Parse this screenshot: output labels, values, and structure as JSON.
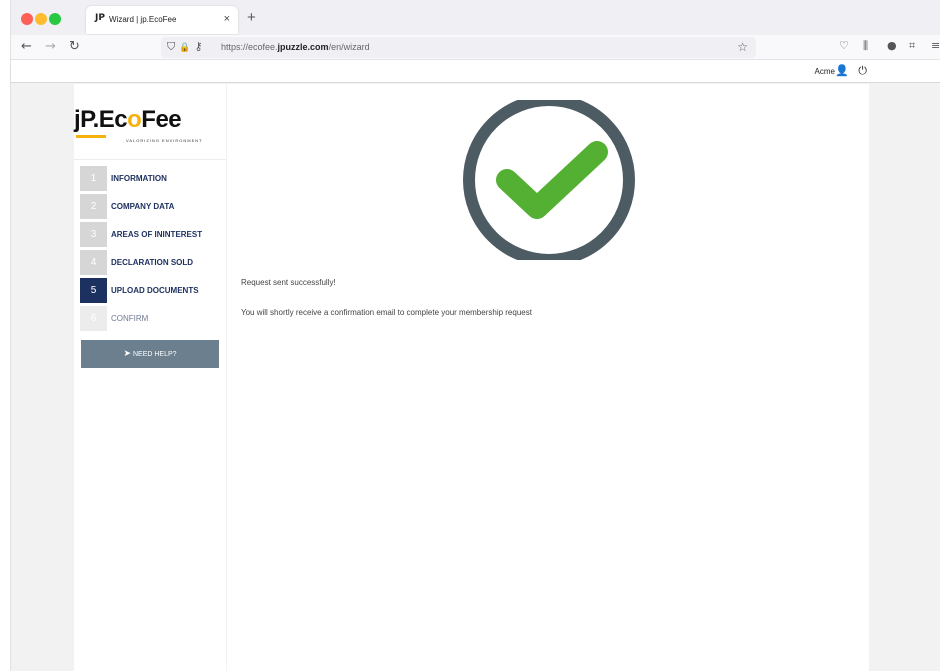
{
  "browser": {
    "tab_title": "Wizard | jp.EcoFee",
    "tab_favicon": "JP",
    "tab_close": "×",
    "new_tab": "+",
    "url_prefix": "https://ecofee.",
    "url_domain": "jpuzzle.com",
    "url_path": "/en/wizard"
  },
  "icons": {
    "back": "←",
    "forward": "→",
    "reload": "↻",
    "shield": "⛉",
    "lock": "🔒",
    "key": "⚷",
    "star": "☆",
    "pocket": "♡",
    "library": "⫼",
    "info": "●",
    "crop": "⌗",
    "menu": "≡",
    "user": "👤",
    "power": "⏻",
    "plane": "➤"
  },
  "header": {
    "user_name": "Acme"
  },
  "logo": {
    "brand_part1": "jP",
    "brand_separator": ".",
    "brand_part2": "Ec",
    "brand_accent": "o",
    "brand_part3": "Fee",
    "tagline": "VALORIZING ENVIRONMENT"
  },
  "steps": [
    {
      "num": "1",
      "label": "INFORMATION",
      "state": "done"
    },
    {
      "num": "2",
      "label": "COMPANY DATA",
      "state": "done"
    },
    {
      "num": "3",
      "label": "AREAS OF ININTEREST",
      "state": "done"
    },
    {
      "num": "4",
      "label": "DECLARATION SOLD",
      "state": "done"
    },
    {
      "num": "5",
      "label": "UPLOAD DOCUMENTS",
      "state": "active"
    },
    {
      "num": "6",
      "label": "CONFIRM",
      "state": "disabled"
    }
  ],
  "help_button": {
    "label": "NEED HELP?"
  },
  "main": {
    "success_title": "Request sent successfully!",
    "success_message": "You will shortly receive a confirmation email to complete your membership request"
  },
  "colors": {
    "check_green": "#53b033",
    "ring_gray": "#4d5b63",
    "active_step": "#1d3160",
    "help_button": "#6b7f8f",
    "accent_yellow": "#f5b20e"
  }
}
